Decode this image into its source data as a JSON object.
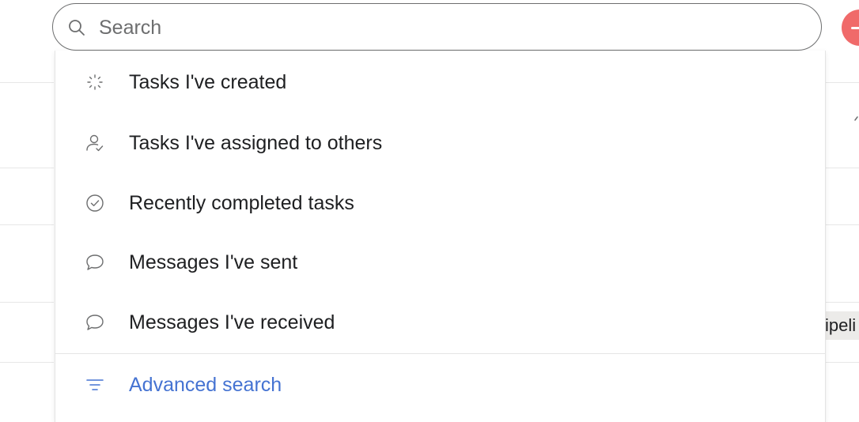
{
  "search": {
    "placeholder": "Search",
    "value": ""
  },
  "menu": {
    "items": [
      {
        "label": "Tasks I've created",
        "icon": "sparkle-loader-icon"
      },
      {
        "label": "Tasks I've assigned to others",
        "icon": "person-check-icon"
      },
      {
        "label": "Recently completed tasks",
        "icon": "check-circle-icon"
      },
      {
        "label": "Messages I've sent",
        "icon": "speech-bubble-icon"
      },
      {
        "label": "Messages I've received",
        "icon": "speech-bubble-icon"
      }
    ],
    "advanced": {
      "label": "Advanced search",
      "icon": "filter-icon"
    }
  },
  "background": {
    "peek_text": "ipeli"
  },
  "colors": {
    "accent_link": "#4573d2",
    "add_button": "#f06a6a",
    "text": "#1e1f21",
    "muted": "#6d6e6f"
  }
}
